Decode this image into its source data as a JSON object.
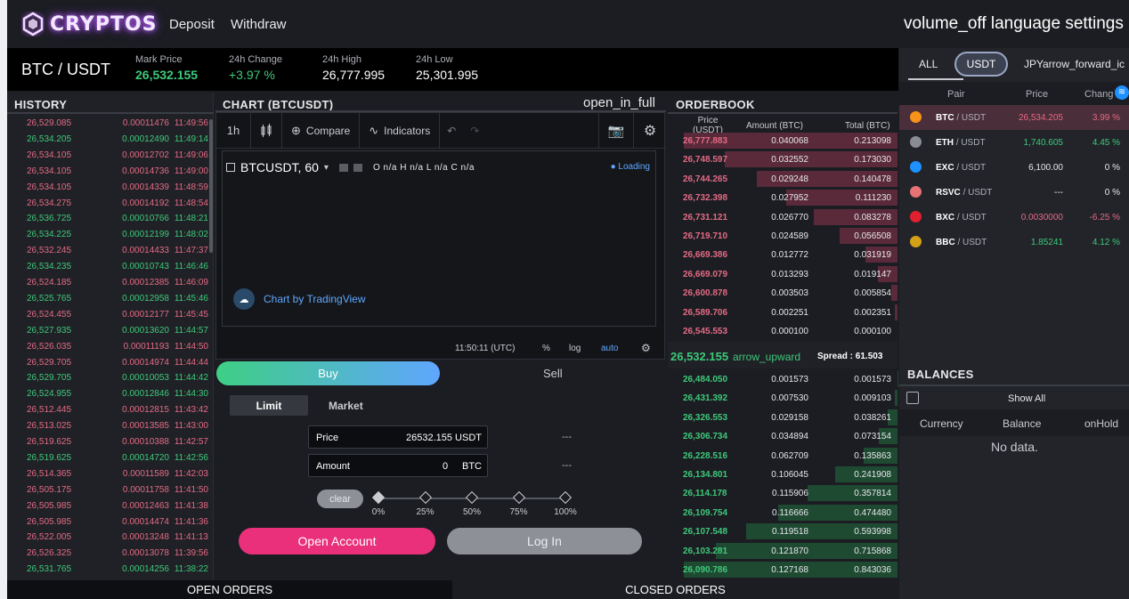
{
  "nav": {
    "brand": "CRYPTOS",
    "links": [
      "Deposit",
      "Withdraw"
    ],
    "right_icons_text": "volume_off language settings help"
  },
  "ticker": {
    "pair": "BTC / USDT",
    "stats": [
      {
        "label": "Mark Price",
        "value": "26,532.155"
      },
      {
        "label": "24h Change",
        "value": "+3.97 %"
      },
      {
        "label": "24h High",
        "value": "26,777.995"
      },
      {
        "label": "24h Low",
        "value": "25,301.995"
      }
    ]
  },
  "history": {
    "title": "HISTORY",
    "rows": [
      {
        "price": "26,529.085",
        "amount": "0.00011476",
        "time": "11:49:56",
        "side": "red"
      },
      {
        "price": "26,534.205",
        "amount": "0.00012490",
        "time": "11:49:14",
        "side": "green"
      },
      {
        "price": "26,534.105",
        "amount": "0.00012702",
        "time": "11:49:06",
        "side": "red"
      },
      {
        "price": "26,534.105",
        "amount": "0.00014736",
        "time": "11:49:00",
        "side": "red"
      },
      {
        "price": "26,534.105",
        "amount": "0.00014339",
        "time": "11:48:59",
        "side": "red"
      },
      {
        "price": "26,534.275",
        "amount": "0.00014192",
        "time": "11:48:54",
        "side": "red"
      },
      {
        "price": "26,536.725",
        "amount": "0.00010766",
        "time": "11:48:21",
        "side": "green"
      },
      {
        "price": "26,534.225",
        "amount": "0.00012199",
        "time": "11:48:02",
        "side": "green"
      },
      {
        "price": "26,532.245",
        "amount": "0.00014433",
        "time": "11:47:37",
        "side": "red"
      },
      {
        "price": "26,534.235",
        "amount": "0.00010743",
        "time": "11:46:46",
        "side": "green"
      },
      {
        "price": "26,524.185",
        "amount": "0.00012385",
        "time": "11:46:09",
        "side": "red"
      },
      {
        "price": "26,525.765",
        "amount": "0.00012958",
        "time": "11:45:46",
        "side": "green"
      },
      {
        "price": "26,524.455",
        "amount": "0.00012177",
        "time": "11:45:45",
        "side": "red"
      },
      {
        "price": "26,527.935",
        "amount": "0.00013620",
        "time": "11:44:57",
        "side": "green"
      },
      {
        "price": "26,526.035",
        "amount": "0.00011193",
        "time": "11:44:50",
        "side": "red"
      },
      {
        "price": "26,529.705",
        "amount": "0.00014974",
        "time": "11:44:44",
        "side": "red"
      },
      {
        "price": "26,529.705",
        "amount": "0.00010053",
        "time": "11:44:42",
        "side": "green"
      },
      {
        "price": "26,524.955",
        "amount": "0.00012846",
        "time": "11:44:30",
        "side": "green"
      },
      {
        "price": "26,512.445",
        "amount": "0.00012815",
        "time": "11:43:42",
        "side": "red"
      },
      {
        "price": "26,513.025",
        "amount": "0.00013585",
        "time": "11:43:00",
        "side": "red"
      },
      {
        "price": "26,519.625",
        "amount": "0.00010388",
        "time": "11:42:57",
        "side": "red"
      },
      {
        "price": "26,519.625",
        "amount": "0.00014720",
        "time": "11:42:56",
        "side": "green"
      },
      {
        "price": "26,514.365",
        "amount": "0.00011589",
        "time": "11:42:03",
        "side": "red"
      },
      {
        "price": "26,505.175",
        "amount": "0.00011758",
        "time": "11:41:50",
        "side": "red"
      },
      {
        "price": "26,505.985",
        "amount": "0.00012463",
        "time": "11:41:38",
        "side": "red"
      },
      {
        "price": "26,505.985",
        "amount": "0.00014474",
        "time": "11:41:36",
        "side": "red"
      },
      {
        "price": "26,522.005",
        "amount": "0.00013248",
        "time": "11:41:13",
        "side": "red"
      },
      {
        "price": "26,526.325",
        "amount": "0.00013078",
        "time": "11:39:56",
        "side": "red"
      },
      {
        "price": "26,531.765",
        "amount": "0.00014256",
        "time": "11:38:22",
        "side": "green"
      }
    ]
  },
  "chart": {
    "title": "CHART (BTCUSDT)",
    "expand_icon_text": "open_in_full",
    "interval": "1h",
    "compare": "Compare",
    "indicators": "Indicators",
    "symbol": "BTCUSDT, 60",
    "ohlc": "O n/a  H n/a  L n/a  C n/a",
    "loading": "● Loading",
    "attribution": "Chart by TradingView",
    "time": "11:50:11 (UTC)",
    "pct": "%",
    "log": "log",
    "auto": "auto"
  },
  "orderbook": {
    "title": "ORDERBOOK",
    "headers": [
      "Price (USDT)",
      "Amount (BTC)",
      "Total (BTC)"
    ],
    "asks": [
      {
        "price": "26,777.883",
        "amount": "0.040068",
        "total": "0.213098",
        "depth": 1.0
      },
      {
        "price": "26,748.597",
        "amount": "0.032552",
        "total": "0.173030",
        "depth": 0.81
      },
      {
        "price": "26,744.265",
        "amount": "0.029248",
        "total": "0.140478",
        "depth": 0.66
      },
      {
        "price": "26,732.398",
        "amount": "0.027952",
        "total": "0.111230",
        "depth": 0.52
      },
      {
        "price": "26,731.121",
        "amount": "0.026770",
        "total": "0.083278",
        "depth": 0.39
      },
      {
        "price": "26,719.710",
        "amount": "0.024589",
        "total": "0.056508",
        "depth": 0.27
      },
      {
        "price": "26,669.386",
        "amount": "0.012772",
        "total": "0.031919",
        "depth": 0.15
      },
      {
        "price": "26,669.079",
        "amount": "0.013293",
        "total": "0.019147",
        "depth": 0.09
      },
      {
        "price": "26,600.878",
        "amount": "0.003503",
        "total": "0.005854",
        "depth": 0.03
      },
      {
        "price": "26,589.706",
        "amount": "0.002251",
        "total": "0.002351",
        "depth": 0.012
      },
      {
        "price": "26,545.553",
        "amount": "0.000100",
        "total": "0.000100",
        "depth": 0.0
      }
    ],
    "mid_price": "26,532.155",
    "mid_arrow": "arrow_upward",
    "spread": "Spread : 61.503",
    "bids": [
      {
        "price": "26,484.050",
        "amount": "0.001573",
        "total": "0.001573",
        "depth": 0.002
      },
      {
        "price": "26,431.392",
        "amount": "0.007530",
        "total": "0.009103",
        "depth": 0.011
      },
      {
        "price": "26,326.553",
        "amount": "0.029158",
        "total": "0.038261",
        "depth": 0.045
      },
      {
        "price": "26,306.734",
        "amount": "0.034894",
        "total": "0.073154",
        "depth": 0.087
      },
      {
        "price": "26,228.516",
        "amount": "0.062709",
        "total": "0.135863",
        "depth": 0.16
      },
      {
        "price": "26,134.801",
        "amount": "0.106045",
        "total": "0.241908",
        "depth": 0.29
      },
      {
        "price": "26,114.178",
        "amount": "0.115906",
        "total": "0.357814",
        "depth": 0.42
      },
      {
        "price": "26,109.754",
        "amount": "0.116666",
        "total": "0.474480",
        "depth": 0.56
      },
      {
        "price": "26,107.548",
        "amount": "0.119518",
        "total": "0.593998",
        "depth": 0.71
      },
      {
        "price": "26,103.281",
        "amount": "0.121870",
        "total": "0.715868",
        "depth": 0.85
      },
      {
        "price": "26,090.786",
        "amount": "0.127168",
        "total": "0.843036",
        "depth": 1.0
      }
    ]
  },
  "markets": {
    "tabs": [
      "ALL",
      "USDT",
      "JPY"
    ],
    "tab_arrow_text": "arrow_forward_ic",
    "headers": [
      "Pair",
      "Price",
      "Chang"
    ],
    "rows": [
      {
        "base": "BTC",
        "quote": " / USDT",
        "price": "26,534.205",
        "change": "3.99 %",
        "color": "#f7931a",
        "price_class": "red",
        "change_class": "red"
      },
      {
        "base": "ETH",
        "quote": " / USDT",
        "price": "1,740.605",
        "change": "4.45 %",
        "color": "#8a8d94",
        "price_class": "green",
        "change_class": "green"
      },
      {
        "base": "EXC",
        "quote": " / USDT",
        "price": "6,100.00",
        "change": "0 %",
        "color": "#1e90ff",
        "price_class": "plain",
        "change_class": "plain"
      },
      {
        "base": "RSVC",
        "quote": " / USDT",
        "price": "---",
        "change": "0 %",
        "color": "#e57373",
        "price_class": "plain",
        "change_class": "plain"
      },
      {
        "base": "BXC",
        "quote": " / USDT",
        "price": "0.0030000",
        "change": "-6.25 %",
        "color": "#e0202e",
        "price_class": "red",
        "change_class": "red"
      },
      {
        "base": "BBC",
        "quote": " / USDT",
        "price": "1.85241",
        "change": "4.12 %",
        "color": "#d4a017",
        "price_class": "green",
        "change_class": "green"
      }
    ]
  },
  "balances": {
    "title": "BALANCES",
    "show_all": "Show All",
    "headers": [
      "Currency",
      "Balance",
      "onHold"
    ],
    "empty": "No data."
  },
  "trade": {
    "buy": "Buy",
    "sell": "Sell",
    "limit": "Limit",
    "market": "Market",
    "price_label": "Price",
    "price_value": "26532.155 USDT",
    "amount_label": "Amount",
    "amount_value": "0",
    "amount_unit": "BTC",
    "dash": "---",
    "clear": "clear",
    "slider_marks": [
      "0%",
      "25%",
      "50%",
      "75%",
      "100%"
    ],
    "slider_value": 0,
    "open_account": "Open Account",
    "login": "Log In"
  },
  "bottom": {
    "open_orders": "OPEN ORDERS",
    "closed_orders": "CLOSED ORDERS"
  }
}
